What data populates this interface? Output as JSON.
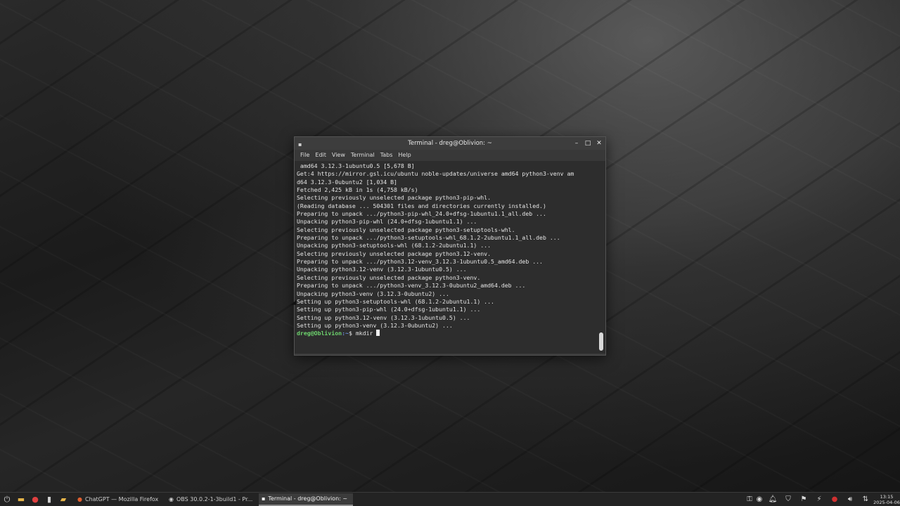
{
  "terminal": {
    "title": "Terminal - dreg@Oblivion: ~",
    "menu": [
      "File",
      "Edit",
      "View",
      "Terminal",
      "Tabs",
      "Help"
    ],
    "lines": [
      " amd64 3.12.3-1ubuntu0.5 [5,678 B]",
      "Get:4 https://mirror.gsl.icu/ubuntu noble-updates/universe amd64 python3-venv am",
      "d64 3.12.3-0ubuntu2 [1,034 B]",
      "Fetched 2,425 kB in 1s (4,758 kB/s)",
      "Selecting previously unselected package python3-pip-whl.",
      "(Reading database ... 504301 files and directories currently installed.)",
      "Preparing to unpack .../python3-pip-whl_24.0+dfsg-1ubuntu1.1_all.deb ...",
      "Unpacking python3-pip-whl (24.0+dfsg-1ubuntu1.1) ...",
      "Selecting previously unselected package python3-setuptools-whl.",
      "Preparing to unpack .../python3-setuptools-whl_68.1.2-2ubuntu1.1_all.deb ...",
      "Unpacking python3-setuptools-whl (68.1.2-2ubuntu1.1) ...",
      "Selecting previously unselected package python3.12-venv.",
      "Preparing to unpack .../python3.12-venv_3.12.3-1ubuntu0.5_amd64.deb ...",
      "Unpacking python3.12-venv (3.12.3-1ubuntu0.5) ...",
      "Selecting previously unselected package python3-venv.",
      "Preparing to unpack .../python3-venv_3.12.3-0ubuntu2_amd64.deb ...",
      "Unpacking python3-venv (3.12.3-0ubuntu2) ...",
      "Setting up python3-setuptools-whl (68.1.2-2ubuntu1.1) ...",
      "Setting up python3-pip-whl (24.0+dfsg-1ubuntu1.1) ...",
      "Setting up python3.12-venv (3.12.3-1ubuntu0.5) ...",
      "Setting up python3-venv (3.12.3-0ubuntu2) ..."
    ],
    "prompt": {
      "user_host": "dreg@Oblivion",
      "path": ":~",
      "symbol": "$ ",
      "command": "mkdir "
    }
  },
  "taskbar": {
    "tasks": [
      {
        "label": "ChatGPT — Mozilla Firefox",
        "icon": "firefox-icon",
        "active": false
      },
      {
        "label": "OBS 30.0.2-1-3build1 - Pr...",
        "icon": "obs-icon",
        "active": false
      },
      {
        "label": "Terminal - dreg@Oblivion: ~",
        "icon": "terminal-icon",
        "active": true
      }
    ],
    "clock_time": "13:15",
    "clock_date": "2025-04-06"
  },
  "colors": {
    "prompt_user": "#6dd36d",
    "prompt_path": "#6d8fe0",
    "terminal_bg": "#2d2d2d"
  }
}
